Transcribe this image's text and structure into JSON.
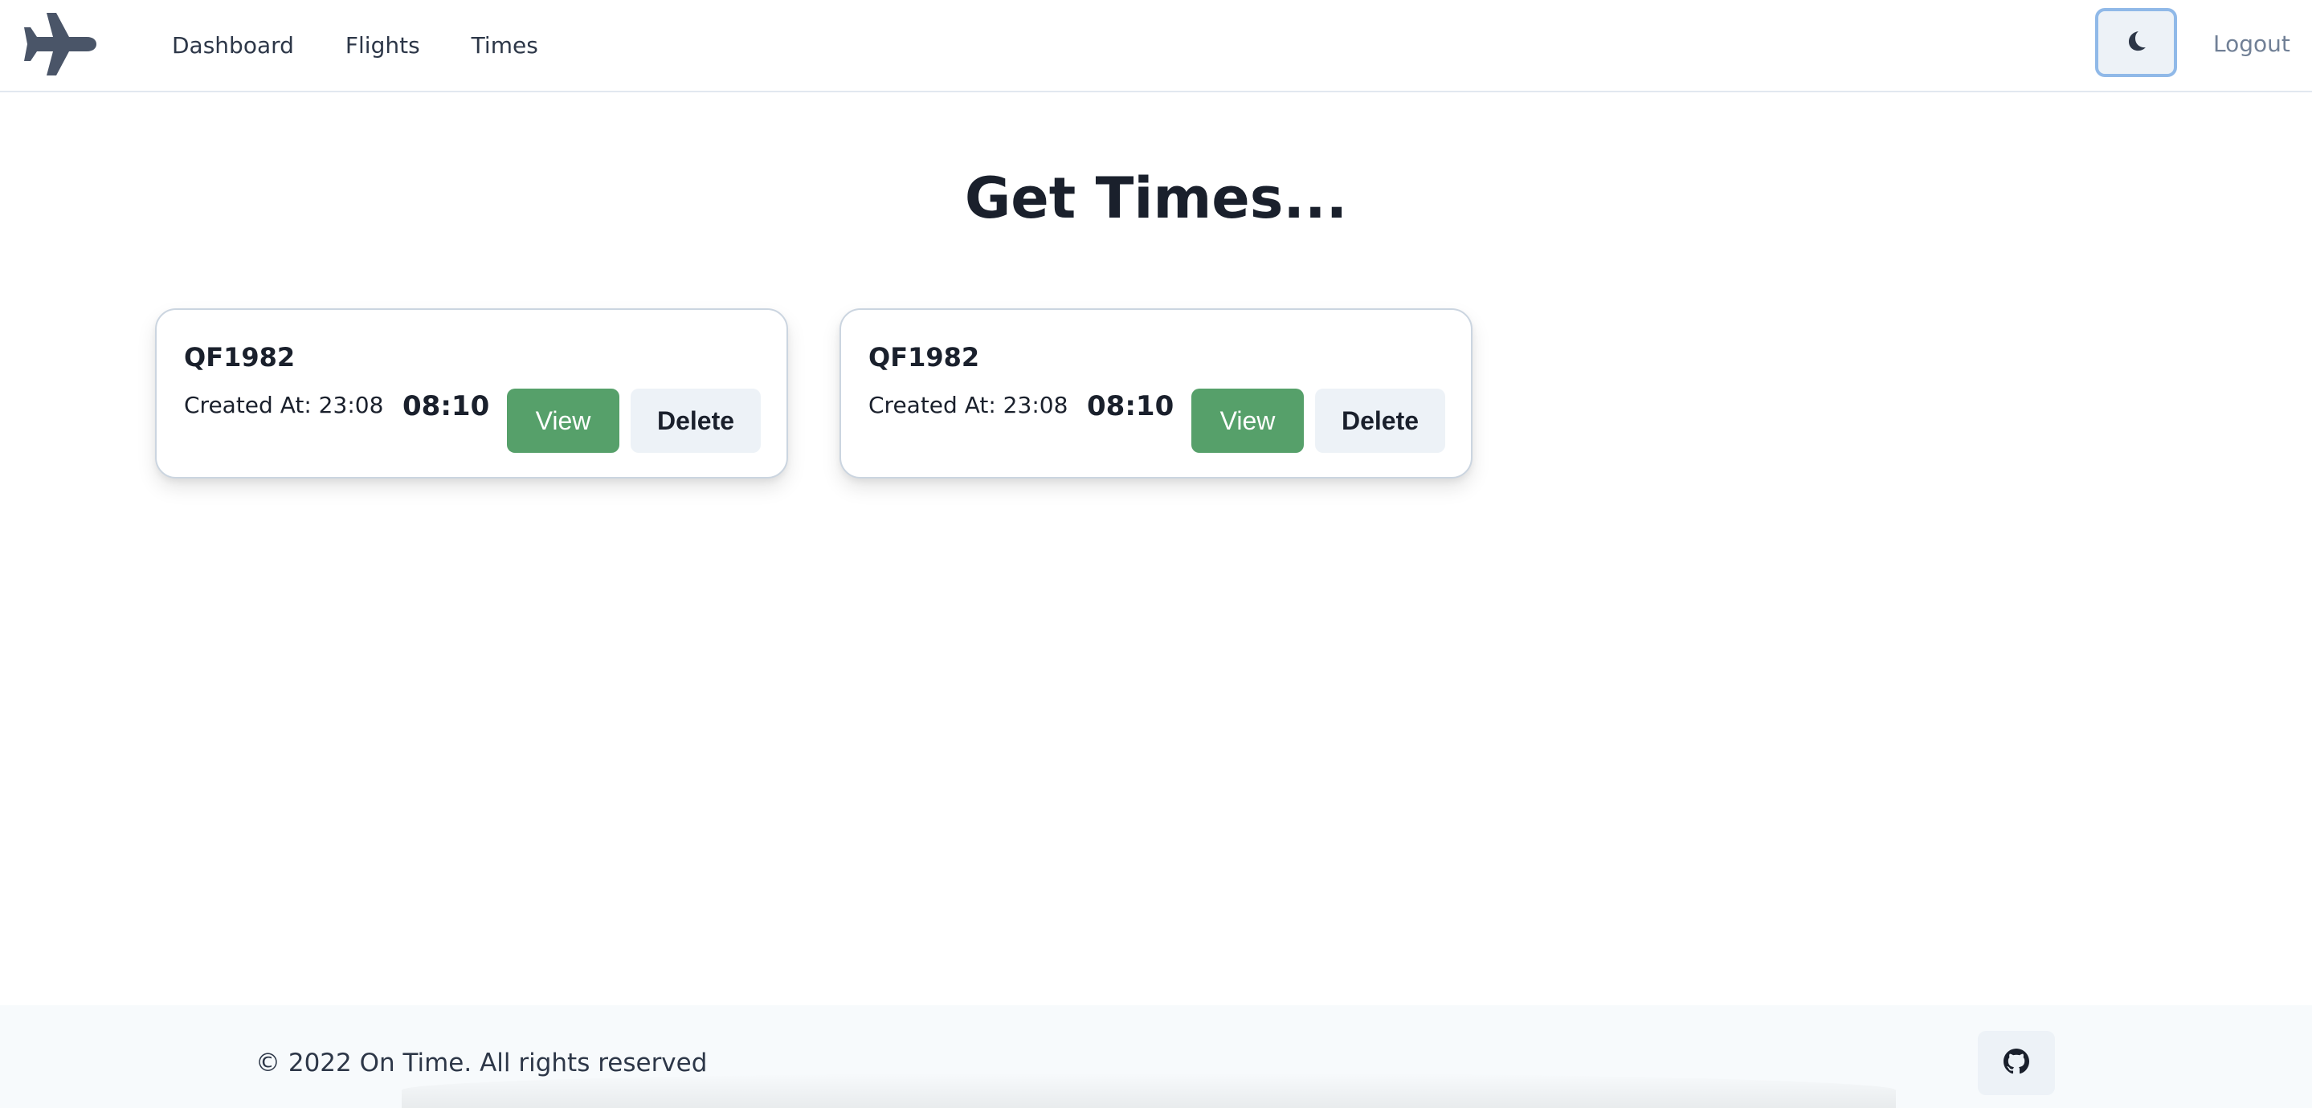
{
  "nav": {
    "logo_icon": "airplane-icon",
    "links": [
      {
        "label": "Dashboard"
      },
      {
        "label": "Flights"
      },
      {
        "label": "Times"
      }
    ],
    "theme_toggle_icon": "moon-icon",
    "logout_label": "Logout"
  },
  "main": {
    "title": "Get Times...",
    "cards": [
      {
        "flight": "QF1982",
        "created": "Created At: 23:08",
        "time": "08:10",
        "view_label": "View",
        "delete_label": "Delete"
      },
      {
        "flight": "QF1982",
        "created": "Created At: 23:08",
        "time": "08:10",
        "view_label": "View",
        "delete_label": "Delete"
      }
    ]
  },
  "footer": {
    "copyright": "© 2022 On Time. All rights reserved",
    "github_icon": "github-icon"
  },
  "colors": {
    "view_button": "#56a06a",
    "header_border": "#e2e8f0",
    "footer_bg": "#f7fafc",
    "focus_ring": "#90b9e8"
  }
}
